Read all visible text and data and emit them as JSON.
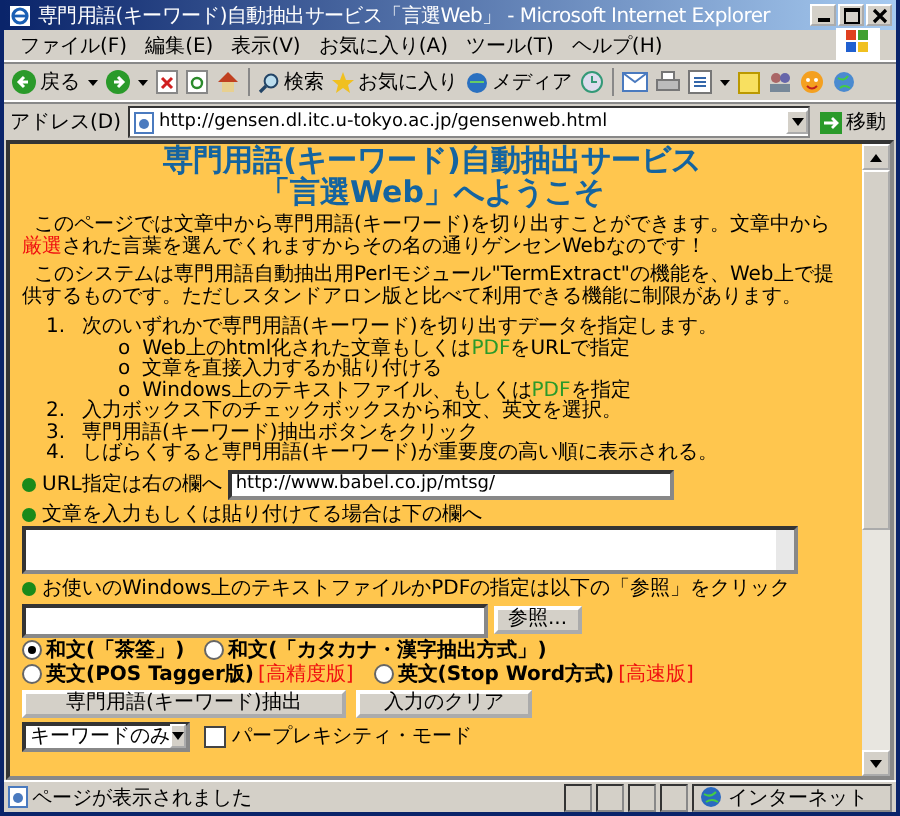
{
  "window": {
    "title": "専門用語(キーワード)自動抽出サービス「言選Web」 - Microsoft Internet Explorer"
  },
  "menu": [
    "ファイル(F)",
    "編集(E)",
    "表示(V)",
    "お気に入り(A)",
    "ツール(T)",
    "ヘルプ(H)"
  ],
  "toolbar": {
    "back": "戻る",
    "search": "検索",
    "favorites": "お気に入り",
    "media": "メディア"
  },
  "address": {
    "label": "アドレス(D)",
    "url": "http://gensen.dl.itc.u-tokyo.ac.jp/gensenweb.html",
    "go": "移動"
  },
  "page": {
    "heading": [
      "専門用語(キーワード)自動抽出サービス",
      "「言選Web」へようこそ"
    ],
    "paragraphs": [
      "このページでは文章中から専門用語(キーワード)を切り出すことができます。文章中から**厳選**された言葉を選んでくれますからその名の通りゲンセンWebなのです！",
      "このシステムは専門用語自動抽出用Perlモジュール\"TermExtract\"の機能を、Web上で提供するものです。ただしスタンドアロン版と比べて利用できる機能に制限があります。"
    ],
    "steps": [
      {
        "number": "1.",
        "text": "次のいずれかで専門用語(キーワード)を切り出すデータを指定します。",
        "children": [
          {
            "bullet": "o",
            "text": "Web上のhtml化された文章もしくは**PDF**をURLで指定"
          },
          {
            "bullet": "o",
            "text": "文章を直接入力するか貼り付ける"
          },
          {
            "bullet": "o",
            "text": "Windows上のテキストファイル、もしくは**PDF**を指定"
          }
        ]
      },
      {
        "number": "2.",
        "text": "入力ボックス下のチェックボックスから和文、英文を選択。"
      },
      {
        "number": "3.",
        "text": "専門用語(キーワード)抽出ボタンをクリック"
      },
      {
        "number": "4.",
        "text": "しばらくすると専門用語(キーワード)が重要度の高い順に表示される。"
      }
    ],
    "url_label": "URL指定は右の欄へ",
    "url_value": "http://www.babel.co.jp/mtsg/",
    "text_label": "文章を入力もしくは貼り付けてる場合は下の欄へ",
    "file_label": "お使いのWindows上のテキストファイルかPDFの指定は以下の「参照」をクリック",
    "browse": "参照...",
    "options": [
      [
        {
          "label": "和文(「茶筌」)",
          "selected": true
        },
        {
          "label": "和文(「カタカナ・漢字抽出方式」)",
          "selected": false
        }
      ],
      [
        {
          "label": "英文(POS Tagger版)",
          "note": "[高精度版]",
          "selected": false
        },
        {
          "label": "英文(Stop Word方式)",
          "note": "[高速版]",
          "selected": false
        }
      ]
    ],
    "buttons": [
      "専門用語(キーワード)抽出",
      "入力のクリア"
    ],
    "mode_select": "キーワードのみ",
    "perplexity": {
      "label": "パープレキシティ・モード",
      "checked": false
    }
  },
  "status_bar": {
    "text": "ページが表示されました",
    "zone": "インターネット"
  }
}
